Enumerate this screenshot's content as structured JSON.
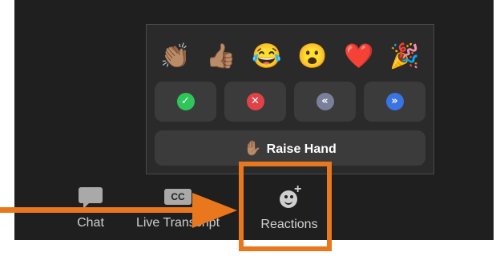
{
  "reactions_popup": {
    "emojis": [
      "👏🏽",
      "👍🏽",
      "😂",
      "😮",
      "❤️",
      "🎉"
    ],
    "status_buttons": [
      {
        "name": "yes",
        "glyph": "✓",
        "color": "#2ec65a"
      },
      {
        "name": "no",
        "glyph": "✕",
        "color": "#e0424a"
      },
      {
        "name": "slow-down",
        "glyph": "«",
        "color": "#7a7f9a"
      },
      {
        "name": "speed-up",
        "glyph": "»",
        "color": "#3a73e3"
      }
    ],
    "raise_hand_emoji": "✋🏽",
    "raise_hand_label": "Raise Hand"
  },
  "toolbar": {
    "chat_label": "Chat",
    "cc_icon_text": "CC",
    "live_transcript_label": "Live Transcript",
    "reactions_label": "Reactions"
  },
  "annotation": {
    "highlight_color": "#e8771e"
  }
}
